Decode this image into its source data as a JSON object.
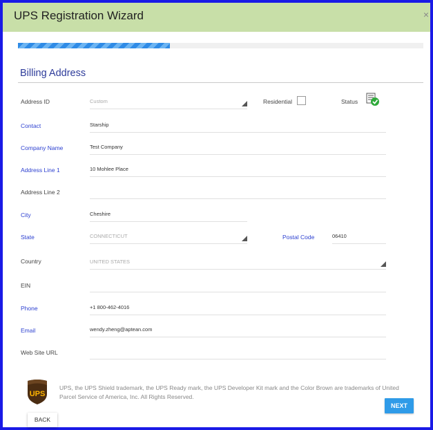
{
  "window": {
    "title": "UPS Registration Wizard",
    "close_glyph": "×"
  },
  "progress": {
    "fraction": 0.375
  },
  "section": {
    "title": "Billing Address"
  },
  "form": {
    "address_id": {
      "label": "Address ID",
      "value": "Custom",
      "required": false,
      "type": "select"
    },
    "residential": {
      "label": "Residential",
      "checked": false
    },
    "status": {
      "label": "Status",
      "icon": "verified-list-icon"
    },
    "contact": {
      "label": "Contact",
      "value": "Starship",
      "required": true
    },
    "company_name": {
      "label": "Company Name",
      "value": "Test Company",
      "required": true
    },
    "address_line_1": {
      "label": "Address Line 1",
      "value": "10 Mohlee Place",
      "required": true
    },
    "address_line_2": {
      "label": "Address Line 2",
      "value": "",
      "required": false
    },
    "city": {
      "label": "City",
      "value": "Cheshire",
      "required": true
    },
    "state": {
      "label": "State",
      "value": "CONNECTICUT",
      "required": true,
      "type": "select"
    },
    "postal_code": {
      "label": "Postal Code",
      "value": "06410",
      "required": true
    },
    "country": {
      "label": "Country",
      "value": "UNITED STATES",
      "required": false,
      "type": "select"
    },
    "ein": {
      "label": "EIN",
      "value": "",
      "required": false
    },
    "phone": {
      "label": "Phone",
      "value": "+1 800-462-4016",
      "required": true
    },
    "email": {
      "label": "Email",
      "value": "wendy.zheng@aptean.com",
      "required": true
    },
    "web_site_url": {
      "label": "Web Site URL",
      "value": "",
      "required": false
    }
  },
  "footer": {
    "trademark": "UPS, the UPS Shield trademark, the UPS Ready mark, the UPS Developer Kit mark and the Color Brown are trademarks of United Parcel Service of America, Inc. All Rights Reserved.",
    "logo_text": "UPS",
    "next_label": "NEXT",
    "back_label": "BACK"
  },
  "colors": {
    "titlebar": "#c8dfa8",
    "frame_border": "#1a1ae6",
    "required_label": "#2b3fd0",
    "section_title": "#2d3b9a",
    "next_button": "#2f9be8",
    "progress": "#2f8be6",
    "ups_brown": "#4b2d12",
    "ups_gold": "#ffb500"
  }
}
